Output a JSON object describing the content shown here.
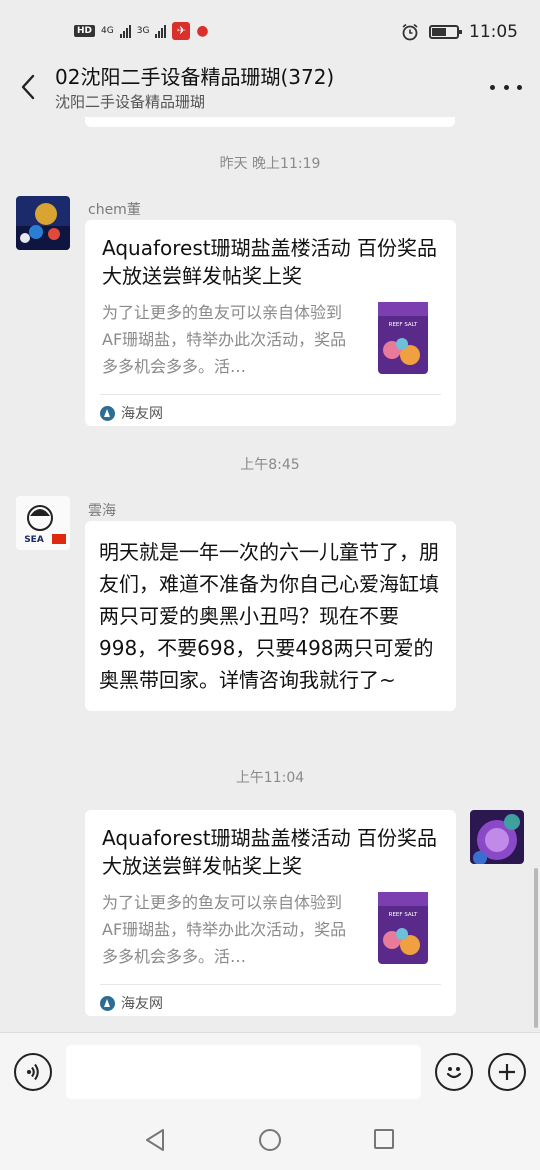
{
  "status_bar": {
    "network_badge": "HD",
    "signal_1": "4G",
    "signal_2": "3G",
    "time": "11:05"
  },
  "nav": {
    "title": "02沈阳二手设备精品珊瑚(372)",
    "subtitle": "沈阳二手设备精品珊瑚",
    "back_icon": "chevron-left-icon",
    "more_icon": "more-dots-icon"
  },
  "messages": [
    {
      "timestamp": "昨天 晚上11:19",
      "sender": "chem董",
      "card": {
        "title": "Aquaforest珊瑚盐盖楼活动 百份奖品大放送尝鲜发帖奖上奖",
        "description": "为了让更多的鱼友可以亲自体验到AF珊瑚盐，特举办此次活动，奖品多多机会多多。活…",
        "source": "海友网",
        "thumb_label": "REEF SALT"
      }
    },
    {
      "timestamp": "上午8:45",
      "sender": "雲海",
      "avatar_text": "SEA",
      "text": "明天就是一年一次的六一儿童节了，朋友们，难道不准备为你自己心爱海缸填两只可爱的奥黑小丑吗？现在不要998，不要698，只要498两只可爱的奥黑带回家。详情咨询我就行了~"
    },
    {
      "timestamp": "上午11:04",
      "card": {
        "title": "Aquaforest珊瑚盐盖楼活动 百份奖品大放送尝鲜发帖奖上奖",
        "description": "为了让更多的鱼友可以亲自体验到AF珊瑚盐，特举办此次活动，奖品多多机会多多。活…",
        "source": "海友网",
        "thumb_label": "REEF SALT"
      }
    }
  ],
  "input_bar": {
    "voice_icon": "voice-icon",
    "emoji_icon": "emoji-icon",
    "plus_icon": "plus-icon",
    "placeholder": ""
  },
  "colors": {
    "background": "#ededed",
    "bubble": "#ffffff",
    "timestamp": "#8a8a8a",
    "source_icon": "#2c6d94"
  }
}
